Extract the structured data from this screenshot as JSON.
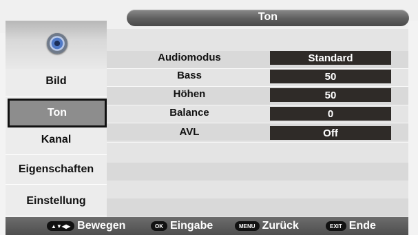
{
  "header": {
    "title": "Ton"
  },
  "sidebar": {
    "items": [
      {
        "label": "Bild"
      },
      {
        "label": "Ton"
      },
      {
        "label": "Kanal"
      },
      {
        "label": "Eigenschaften"
      },
      {
        "label": "Einstellung"
      }
    ],
    "active_index": 1
  },
  "settings": [
    {
      "label": "Audiomodus",
      "value": "Standard"
    },
    {
      "label": "Bass",
      "value": "50"
    },
    {
      "label": "Höhen",
      "value": "50"
    },
    {
      "label": "Balance",
      "value": "0"
    },
    {
      "label": "AVL",
      "value": "Off"
    }
  ],
  "footer": {
    "hints": [
      {
        "key": "▲▼◀▶",
        "label": "Bewegen"
      },
      {
        "key": "OK",
        "label": "Eingabe"
      },
      {
        "key": "MENU",
        "label": "Zurück"
      },
      {
        "key": "EXIT",
        "label": "Ende"
      }
    ]
  },
  "icons": {
    "section_icon": "speaker-icon"
  }
}
